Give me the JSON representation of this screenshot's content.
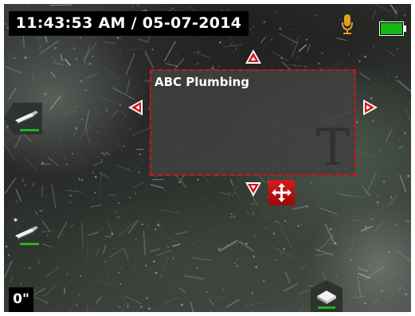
{
  "status_bar": {
    "timestamp": "11:43:53 AM / 05-07-2014",
    "microphone_icon": "microphone-icon",
    "battery_icon": "battery-full-icon",
    "battery_level": 1.0
  },
  "text_overlay": {
    "text": "ABC Plumbing",
    "text_tool_icon": "text-t-icon"
  },
  "controls": {
    "move_up_icon": "arrow-up-icon",
    "move_down_icon": "arrow-down-icon",
    "move_left_icon": "arrow-left-icon",
    "move_right_icon": "arrow-right-icon",
    "move_icon": "move-arrows-icon"
  },
  "side_tabs": [
    {
      "name": "usb-drive-tab",
      "icon": "usb-drive-icon"
    },
    {
      "name": "usb-drive-recording-tab",
      "icon": "usb-drive-icon"
    },
    {
      "name": "storage-tab",
      "icon": "storage-icon"
    }
  ],
  "depth": {
    "value": "0\""
  },
  "colors": {
    "accent": "#d0141a",
    "battery": "#14b814",
    "microphone": "#e0a020",
    "indicator": "#22b422"
  }
}
